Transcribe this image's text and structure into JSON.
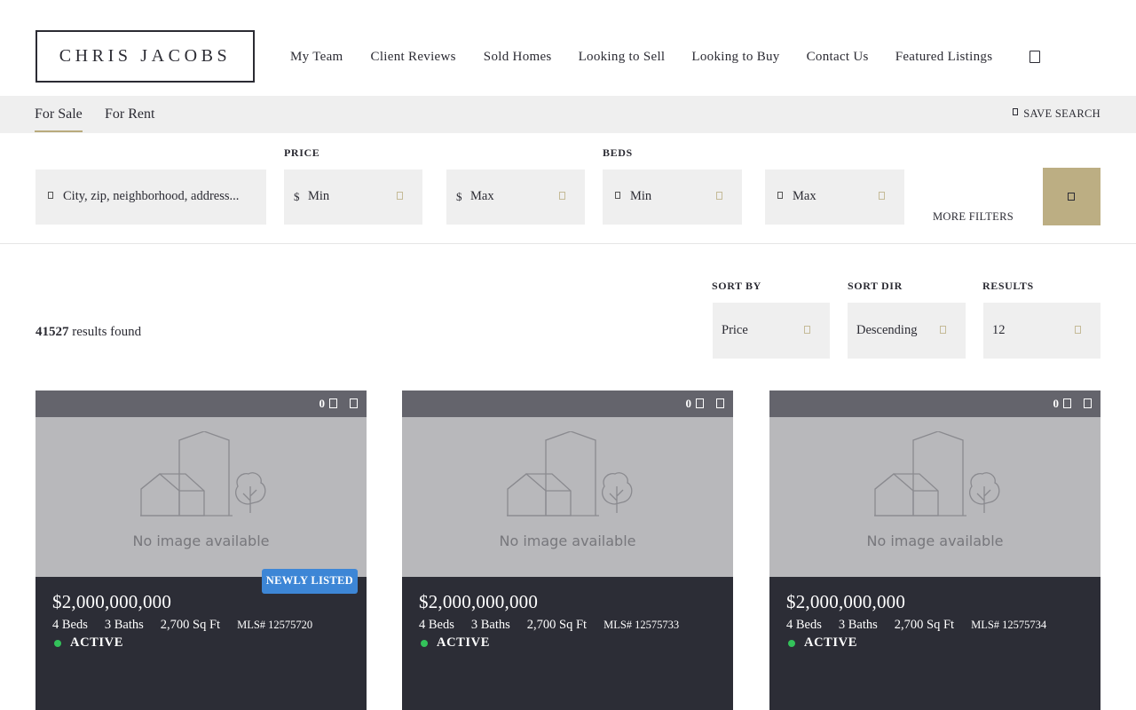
{
  "header": {
    "logo": "CHRIS JACOBS",
    "nav": [
      "My Team",
      "Client Reviews",
      "Sold Homes",
      "Looking to Sell",
      "Looking to Buy",
      "Contact Us",
      "Featured Listings"
    ],
    "menu_icon": "menu-icon"
  },
  "tabs": {
    "for_sale": "For Sale",
    "for_rent": "For Rent",
    "save_search": "SAVE SEARCH"
  },
  "search": {
    "location_placeholder": "City, zip, neighborhood, address...",
    "price_label": "PRICE",
    "price_min": "Min",
    "price_max": "Max",
    "currency": "$",
    "beds_label": "BEDS",
    "beds_min": "Min",
    "beds_max": "Max",
    "more_filters": "MORE FILTERS"
  },
  "results": {
    "count": "41527",
    "suffix": "results found",
    "sort_by_label": "SORT BY",
    "sort_by_value": "Price",
    "sort_dir_label": "SORT DIR",
    "sort_dir_value": "Descending",
    "results_label": "RESULTS",
    "results_value": "12"
  },
  "listings": [
    {
      "favorites": "0",
      "no_image": "No image available",
      "badge": "NEWLY LISTED",
      "price": "$2,000,000,000",
      "beds": "4 Beds",
      "baths": "3 Baths",
      "sqft": "2,700 Sq Ft",
      "mls": "MLS# 12575720",
      "status": "ACTIVE"
    },
    {
      "favorites": "0",
      "no_image": "No image available",
      "badge": "",
      "price": "$2,000,000,000",
      "beds": "4 Beds",
      "baths": "3 Baths",
      "sqft": "2,700 Sq Ft",
      "mls": "MLS# 12575733",
      "status": "ACTIVE"
    },
    {
      "favorites": "0",
      "no_image": "No image available",
      "badge": "",
      "price": "$2,000,000,000",
      "beds": "4 Beds",
      "baths": "3 Baths",
      "sqft": "2,700 Sq Ft",
      "mls": "MLS# 12575734",
      "status": "ACTIVE"
    }
  ],
  "colors": {
    "accent": "#bcae83",
    "card_bg": "#2c2d36",
    "badge": "#3d86d6",
    "active_dot": "#33c25a"
  }
}
